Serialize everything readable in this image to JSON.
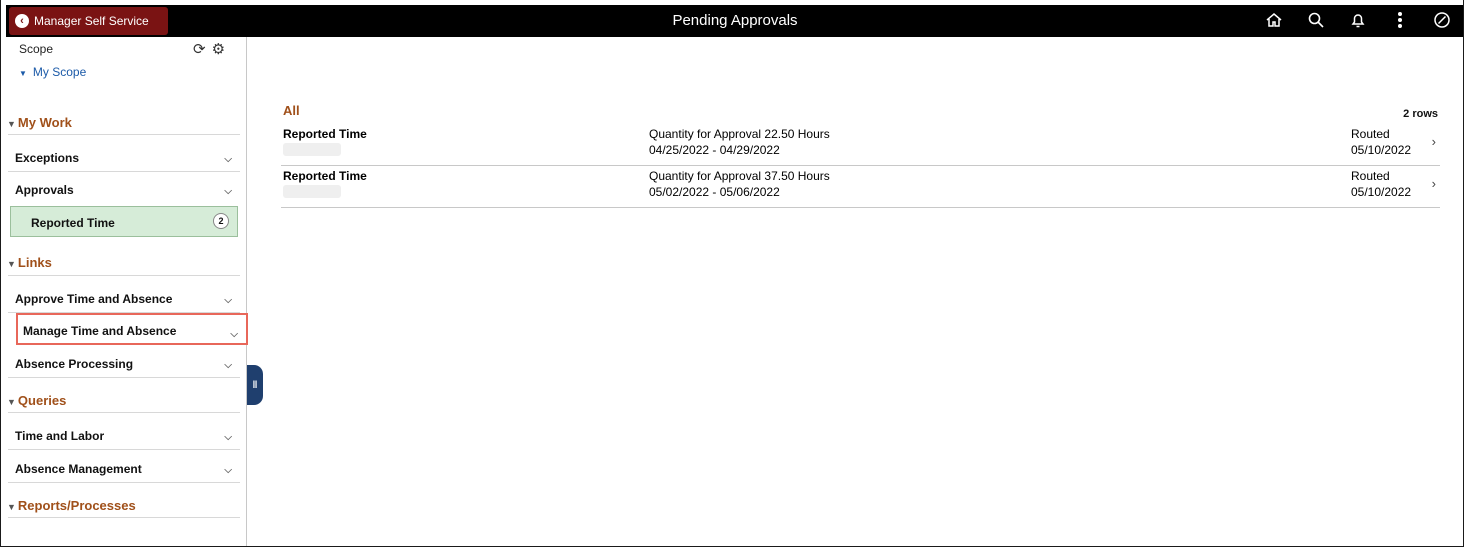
{
  "header": {
    "back_label": "Manager Self Service",
    "title": "Pending Approvals",
    "icons": [
      "home-icon",
      "search-icon",
      "bell-icon",
      "more-icon",
      "compass-icon"
    ]
  },
  "sidebar": {
    "scope_label": "Scope",
    "scope_link": "My Scope",
    "sections": {
      "my_work": "My Work",
      "links": "Links",
      "queries": "Queries",
      "reports": "Reports/Processes"
    },
    "items": {
      "exceptions": "Exceptions",
      "approvals": "Approvals",
      "reported_time": "Reported Time",
      "reported_time_count": "2",
      "approve_time": "Approve Time and Absence",
      "manage_time": "Manage Time and Absence",
      "absence_processing": "Absence Processing",
      "time_labor": "Time and Labor",
      "absence_mgmt": "Absence Management"
    }
  },
  "main": {
    "group_label": "All",
    "row_count": "2 rows",
    "rows": [
      {
        "title": "Reported Time",
        "quantity": "Quantity for Approval 22.50 Hours",
        "period": "04/25/2022 - 04/29/2022",
        "status": "Routed",
        "status_date": "05/10/2022"
      },
      {
        "title": "Reported Time",
        "quantity": "Quantity for Approval 37.50 Hours",
        "period": "05/02/2022 - 05/06/2022",
        "status": "Routed",
        "status_date": "05/10/2022"
      }
    ]
  }
}
